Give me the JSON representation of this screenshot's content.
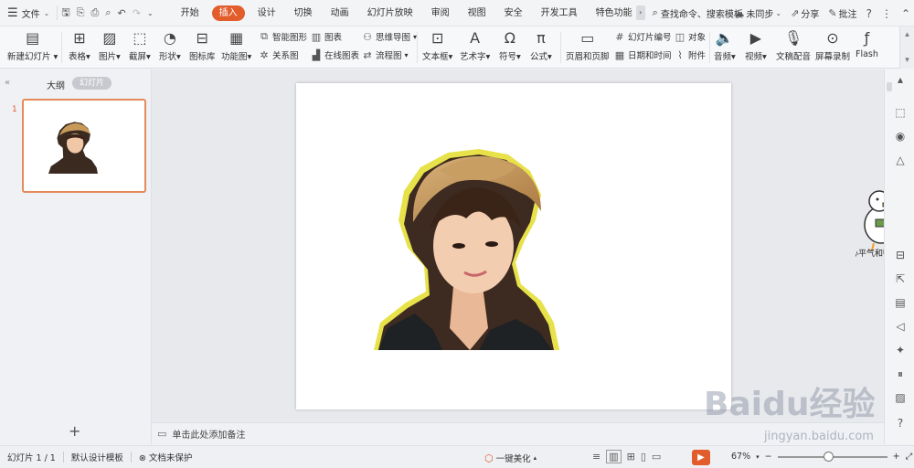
{
  "topbar": {
    "file_label": "文件",
    "tabs": [
      "开始",
      "插入",
      "设计",
      "切换",
      "动画",
      "幻灯片放映",
      "审阅",
      "视图",
      "安全",
      "开发工具",
      "特色功能"
    ],
    "active_tab": "插入",
    "search_text": "查找命令、搜索模板",
    "sync_label": "未同步",
    "share_label": "分享",
    "comment_label": "批注",
    "help_symbol": "?"
  },
  "ribbon": {
    "new_slide": "新建幻灯片",
    "table": "表格",
    "picture": "图片",
    "screenshot": "截屏",
    "shape": "形状",
    "icon_lib": "图标库",
    "function_chart": "功能图",
    "smart_art": "智能图形",
    "chart": "图表",
    "relation_chart": "关系图",
    "online_chart": "在线图表",
    "mind_map": "思维导图",
    "flowchart": "流程图",
    "textbox": "文本框",
    "word_art": "艺术字",
    "symbol": "符号",
    "formula": "公式",
    "header_footer": "页眉和页脚",
    "slide_number": "幻灯片编号",
    "object": "对象",
    "date_time": "日期和时间",
    "attachment": "附件",
    "audio": "音频",
    "video": "视频",
    "doc_dub": "文稿配音",
    "screen_record": "屏幕录制",
    "flash": "Flash"
  },
  "leftpanel": {
    "outline_tab": "大纲",
    "slides_tab": "幻灯片",
    "slide_number": "1",
    "add_symbol": "+"
  },
  "notes": {
    "placeholder": "单击此处添加备注"
  },
  "mascot_caption": "心平气和鸭",
  "statusbar": {
    "slide_pos": "幻灯片 1 / 1",
    "template": "默认设计模板",
    "protection": "文档未保护",
    "beautify": "一键美化",
    "zoom": "67%",
    "minus": "−",
    "plus": "+"
  },
  "watermark": {
    "brand": "Baidu经验",
    "url": "jingyan.baidu.com"
  },
  "colors": {
    "accent": "#e25c2c",
    "thumb_border": "#e58a5a",
    "outline_glow": "#e3dd2a"
  }
}
